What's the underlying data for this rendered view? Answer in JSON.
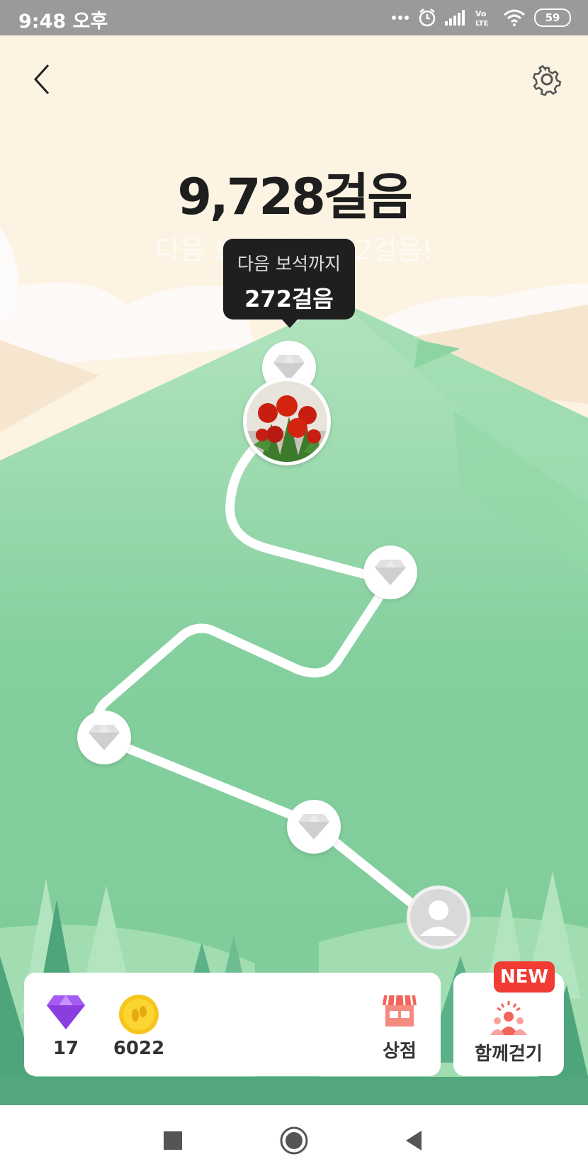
{
  "status_bar": {
    "time": "9:48 오후",
    "battery": "59",
    "icons": [
      "more-dots-icon",
      "alarm-icon",
      "signal-icon",
      "volte-icon",
      "wifi-icon",
      "battery-icon"
    ]
  },
  "header": {
    "back_icon": "chevron-left-icon",
    "settings_icon": "gear-icon"
  },
  "steps": {
    "count": "9,728걸음",
    "subtitle": "다음 보석까지 272걸음!"
  },
  "tooltip": {
    "title": "다음 보석까지",
    "value": "272걸음"
  },
  "path_nodes": [
    {
      "type": "gem",
      "state": "upcoming"
    },
    {
      "type": "avatar-photo",
      "state": "current"
    },
    {
      "type": "gem",
      "state": "collected"
    },
    {
      "type": "gem",
      "state": "collected"
    },
    {
      "type": "gem",
      "state": "collected"
    },
    {
      "type": "user-start",
      "state": "start"
    }
  ],
  "bottom_bar": {
    "gems": {
      "value": "17",
      "icon": "purple-gem-icon"
    },
    "coins": {
      "value": "6022",
      "icon": "footprint-coin-icon"
    },
    "shop": {
      "label": "상점",
      "icon": "store-icon"
    },
    "walk_together": {
      "label": "함께걷기",
      "badge": "NEW",
      "icon": "group-people-icon"
    }
  },
  "colors": {
    "mountain": "#82cd9c",
    "sky": "#fcf3e2",
    "path": "#ffffff",
    "badge": "#f13b33",
    "gem_purple": "#a55cf5",
    "coin_yellow": "#f7c51b",
    "tooltip_bg": "#1f1f1f"
  },
  "nav_bar": {
    "buttons": [
      "recents-square-icon",
      "home-circle-icon",
      "back-triangle-icon"
    ]
  }
}
